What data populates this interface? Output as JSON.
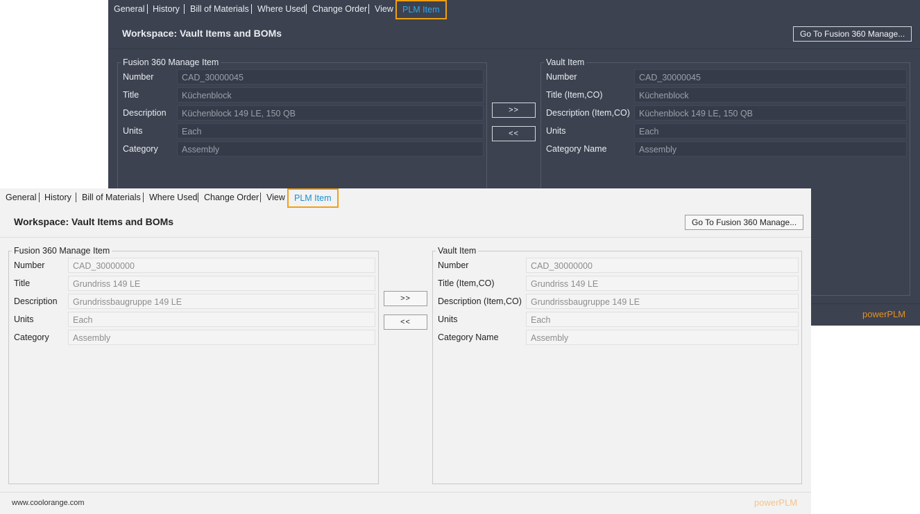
{
  "tabs": [
    "General",
    "History",
    "Bill of Materials",
    "Where Used",
    "Change Order",
    "View",
    "PLM Item"
  ],
  "workspace_title": "Workspace: Vault Items and BOMs",
  "goto_button": "Go To Fusion 360 Manage...",
  "copy_right_button": ">>",
  "copy_left_button": "<<",
  "brand": "powerPLM",
  "website": "www.coolorange.com",
  "colors": {
    "active_tab_border": "#f0a014",
    "active_tab_text": "#2ea8ef",
    "brand_orange": "#e79020",
    "dark_bg": "#3c4250",
    "light_bg": "#f2f2f2"
  },
  "dark": {
    "fusion": {
      "title": "Fusion 360 Manage Item",
      "rows": [
        {
          "label": "Number",
          "value": "CAD_30000045"
        },
        {
          "label": "Title",
          "value": "Küchenblock"
        },
        {
          "label": "Description",
          "value": "Küchenblock 149 LE, 150 QB"
        },
        {
          "label": "Units",
          "value": "Each"
        },
        {
          "label": "Category",
          "value": "Assembly"
        }
      ]
    },
    "vault": {
      "title": "Vault Item",
      "rows": [
        {
          "label": "Number",
          "value": "CAD_30000045"
        },
        {
          "label": "Title (Item,CO)",
          "value": "Küchenblock"
        },
        {
          "label": "Description (Item,CO)",
          "value": "Küchenblock 149 LE, 150 QB"
        },
        {
          "label": "Units",
          "value": "Each"
        },
        {
          "label": "Category Name",
          "value": "Assembly"
        }
      ]
    }
  },
  "light": {
    "fusion": {
      "title": "Fusion 360 Manage Item",
      "rows": [
        {
          "label": "Number",
          "value": "CAD_30000000"
        },
        {
          "label": "Title",
          "value": "Grundriss 149 LE"
        },
        {
          "label": "Description",
          "value": "Grundrissbaugruppe 149 LE"
        },
        {
          "label": "Units",
          "value": "Each"
        },
        {
          "label": "Category",
          "value": "Assembly"
        }
      ]
    },
    "vault": {
      "title": "Vault Item",
      "rows": [
        {
          "label": "Number",
          "value": "CAD_30000000"
        },
        {
          "label": "Title (Item,CO)",
          "value": "Grundriss 149 LE"
        },
        {
          "label": "Description (Item,CO)",
          "value": "Grundrissbaugruppe 149 LE"
        },
        {
          "label": "Units",
          "value": "Each"
        },
        {
          "label": "Category Name",
          "value": "Assembly"
        }
      ]
    }
  }
}
